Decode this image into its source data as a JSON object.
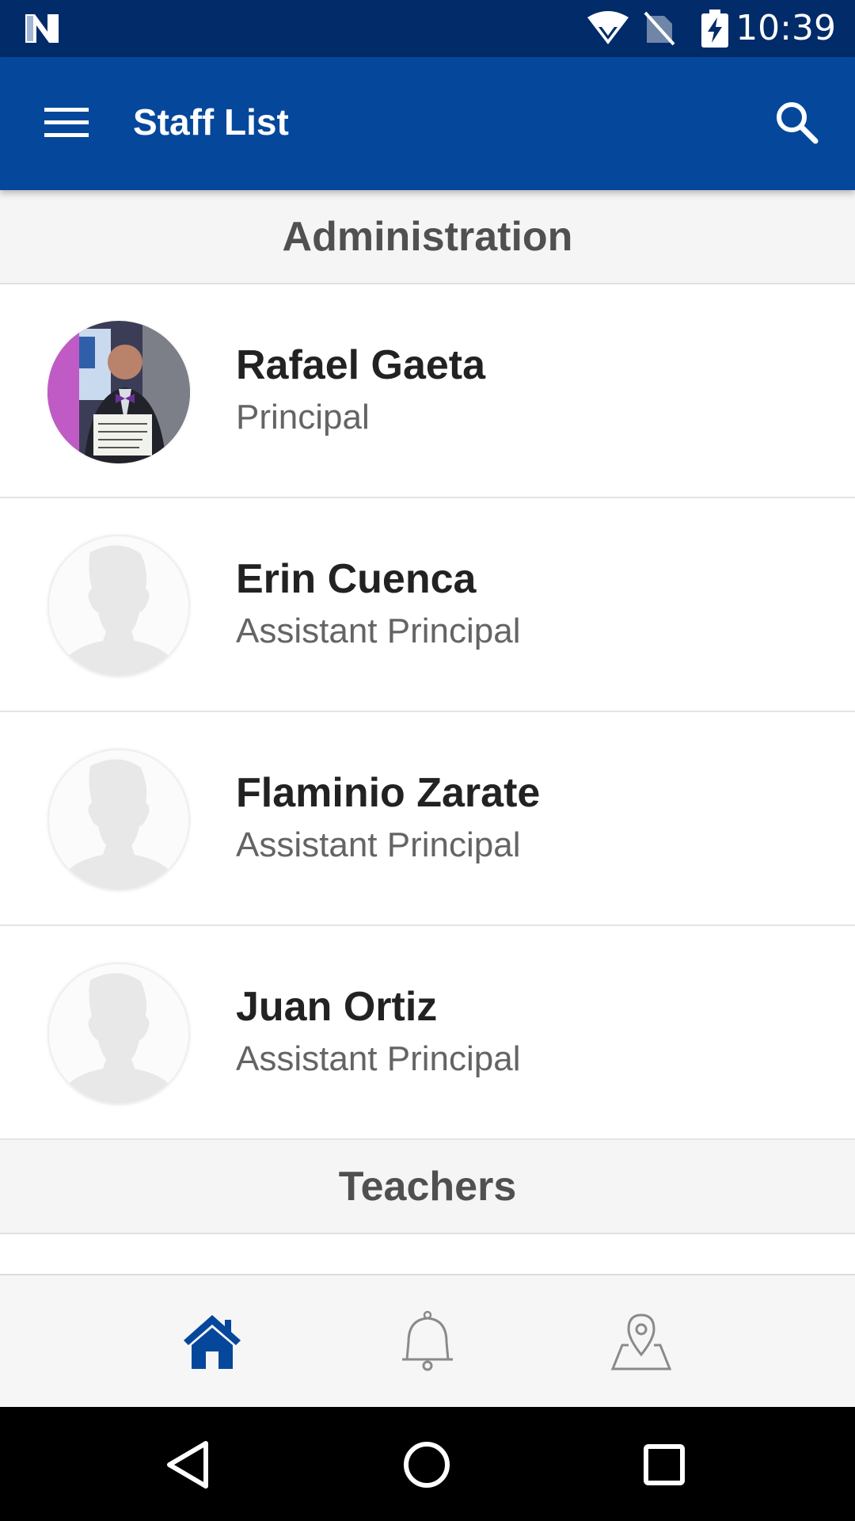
{
  "status_bar": {
    "time": "10:39",
    "icons": [
      "notification-n-icon",
      "wifi-icon",
      "no-sim-icon",
      "battery-charging-icon"
    ]
  },
  "app_bar": {
    "title": "Staff List",
    "icons": [
      "menu-icon",
      "search-icon"
    ]
  },
  "sections": [
    {
      "title": "Administration",
      "staff": [
        {
          "name": "Rafael Gaeta",
          "role": "Principal",
          "avatar": "photo"
        },
        {
          "name": "Erin Cuenca",
          "role": "Assistant Principal",
          "avatar": "placeholder"
        },
        {
          "name": "Flaminio Zarate",
          "role": "Assistant Principal",
          "avatar": "placeholder"
        },
        {
          "name": "Juan Ortiz",
          "role": "Assistant Principal",
          "avatar": "placeholder"
        }
      ]
    },
    {
      "title": "Teachers",
      "staff": []
    }
  ],
  "bottom_nav": {
    "items": [
      "home-icon",
      "bell-icon",
      "map-pin-icon"
    ],
    "active": "home-icon"
  },
  "colors": {
    "status_bar": "#022b69",
    "app_bar": "#05479b",
    "active_nav": "#05479b",
    "inactive_nav": "#8a8a8a",
    "section_bg": "#f5f5f5"
  },
  "system_nav": [
    "back-icon",
    "home-circle-icon",
    "recents-icon"
  ]
}
